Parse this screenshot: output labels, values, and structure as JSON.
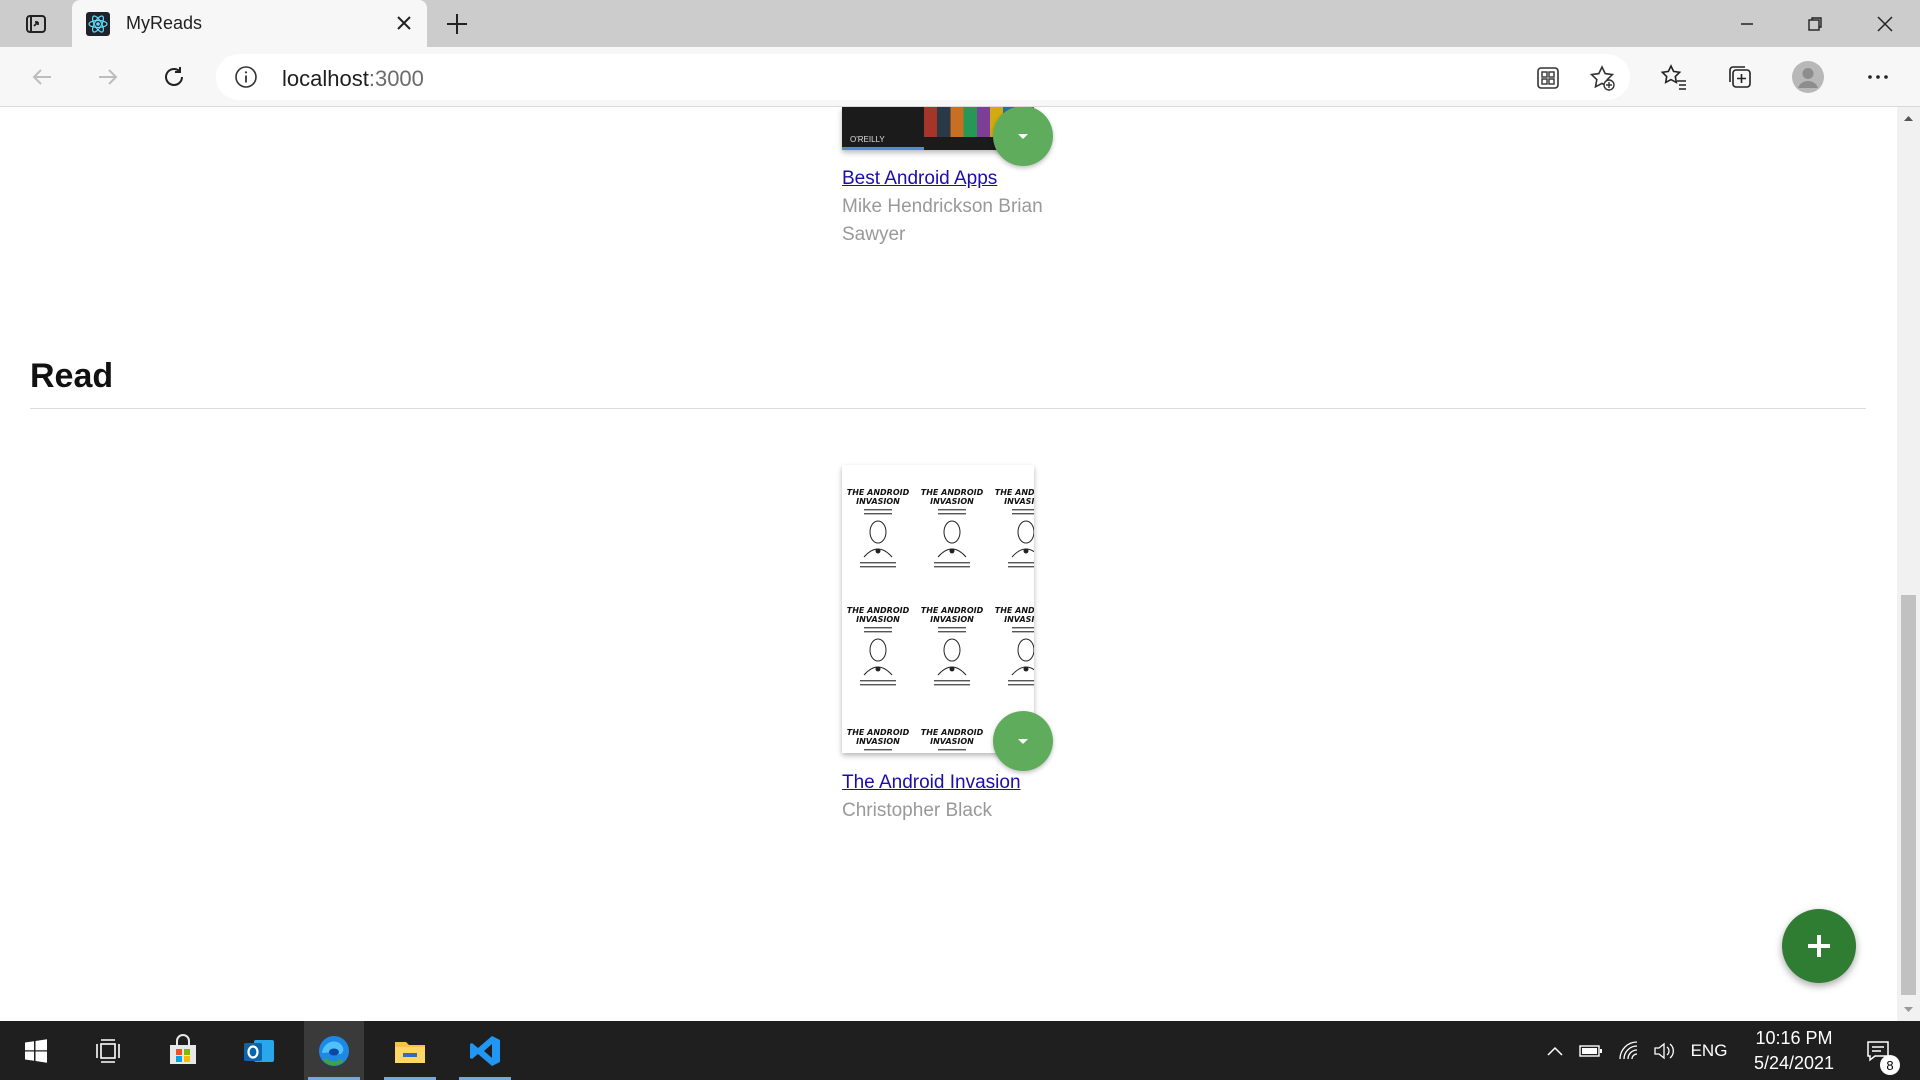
{
  "browser": {
    "tab_title": "MyReads",
    "address_host": "localhost",
    "address_port": ":3000"
  },
  "shelves": [
    {
      "title": "Read",
      "books": [
        {
          "title": "The Android Invasion",
          "authors": "Christopher Black",
          "cover_text": "THE ANDROID INVASION"
        }
      ]
    }
  ],
  "partial_book": {
    "title": "Best Android Apps",
    "authors": "Mike Hendrickson Brian Sawyer",
    "publisher_mark": "O'REILLY"
  },
  "taskbar": {
    "language": "ENG",
    "time": "10:16 PM",
    "date": "5/24/2021",
    "notification_count": "8"
  },
  "colors": {
    "shelf_changer": "#60ac5d",
    "fab": "#2e7d32",
    "link": "#1a0dab",
    "author": "#999999"
  }
}
